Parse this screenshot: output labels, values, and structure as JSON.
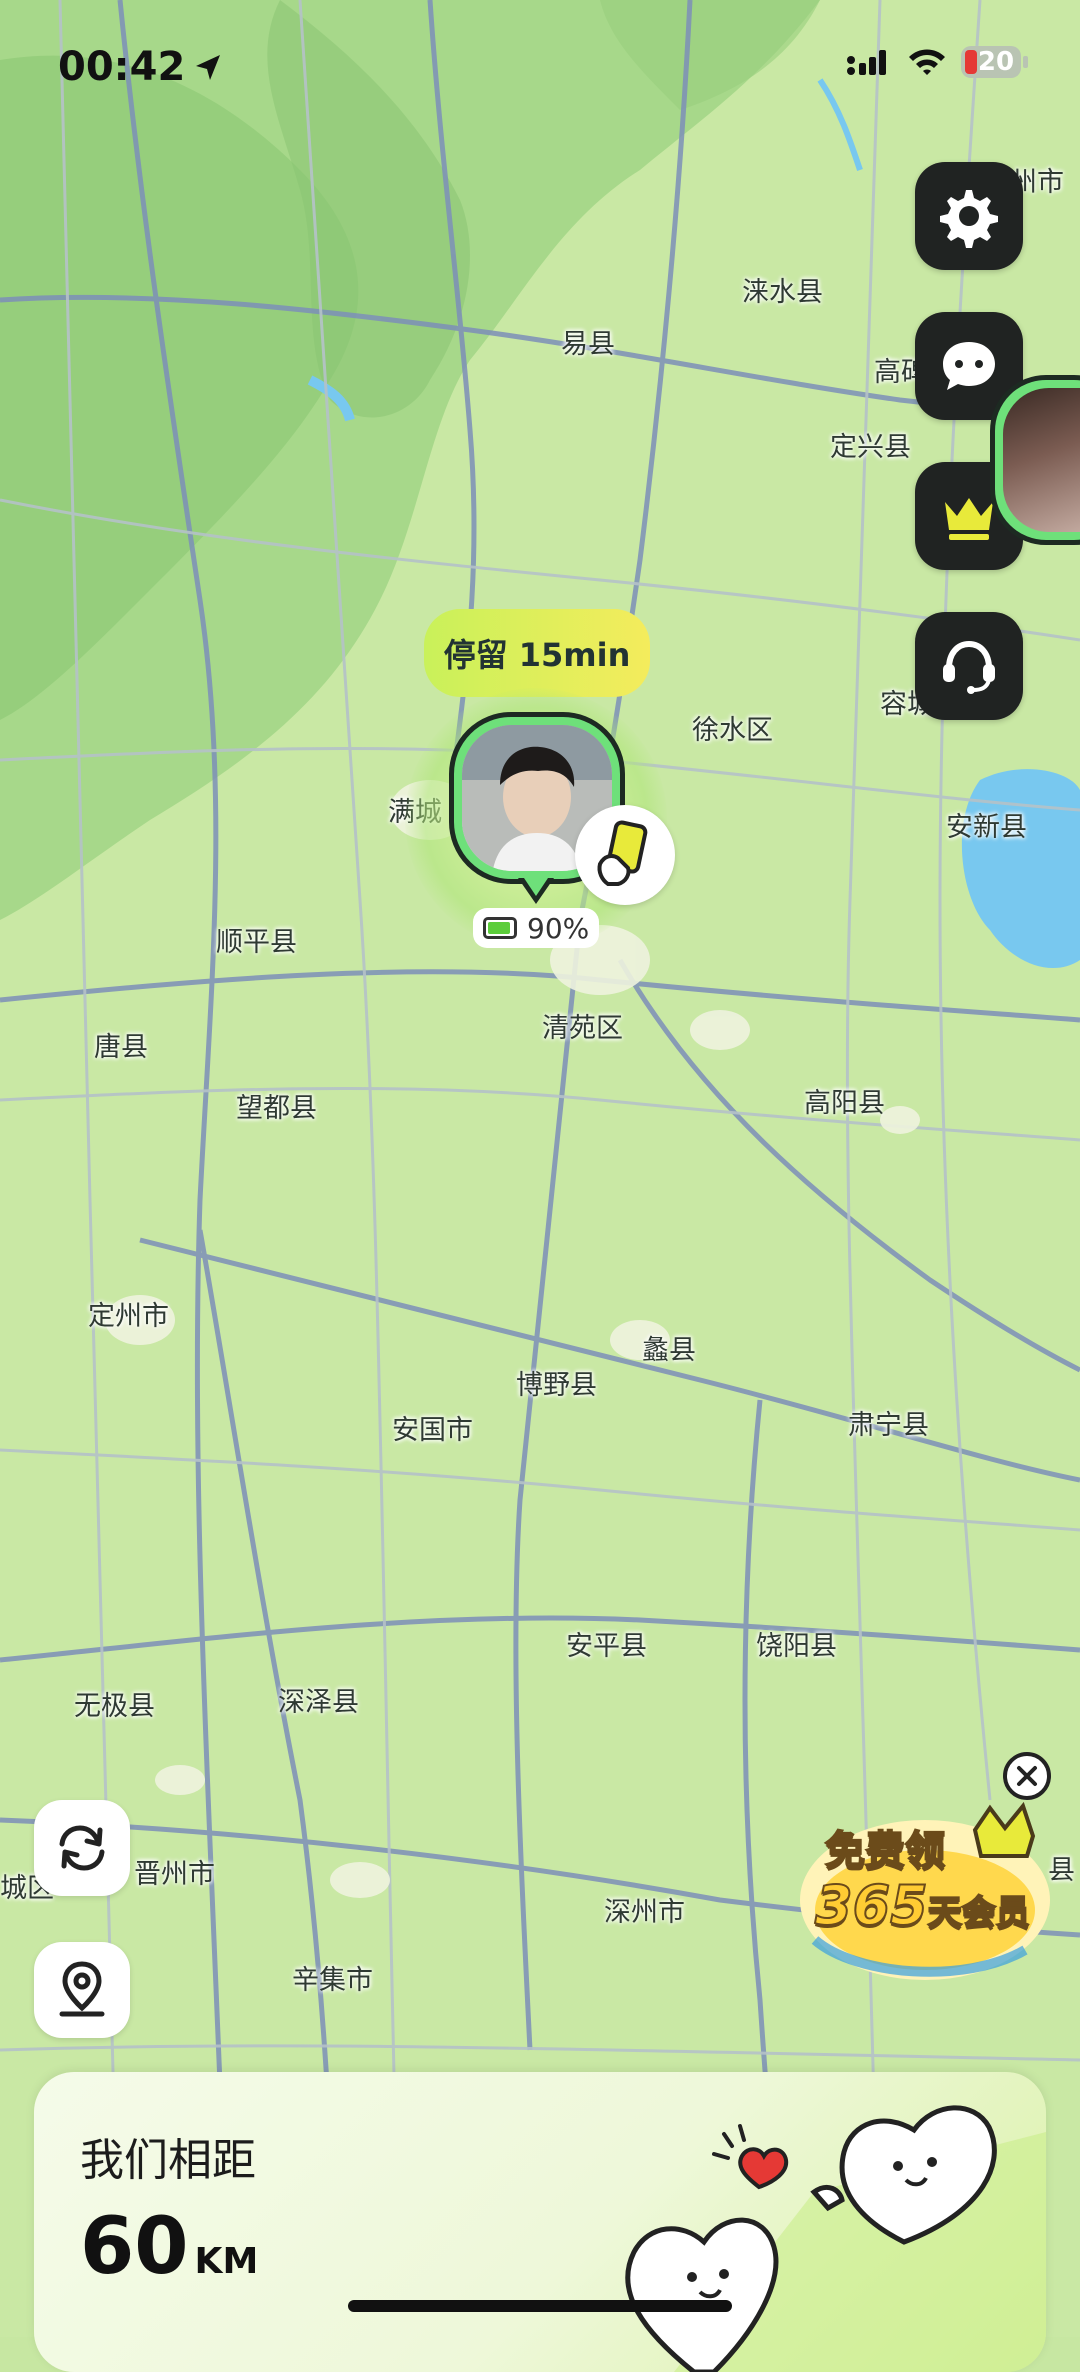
{
  "status_bar": {
    "time": "00:42",
    "battery": "20"
  },
  "map": {
    "labels": [
      {
        "text": "涞水县"
      },
      {
        "text": "易县"
      },
      {
        "text": "高碑"
      },
      {
        "text": "定兴县"
      },
      {
        "text": "州市"
      },
      {
        "text": "容城"
      },
      {
        "text": "徐水区"
      },
      {
        "text": "满城"
      },
      {
        "text": "安新县"
      },
      {
        "text": "顺平县"
      },
      {
        "text": "清苑区"
      },
      {
        "text": "唐县"
      },
      {
        "text": "望都县"
      },
      {
        "text": "高阳县"
      },
      {
        "text": "定州市"
      },
      {
        "text": "蠡县"
      },
      {
        "text": "博野县"
      },
      {
        "text": "安国市"
      },
      {
        "text": "肃宁县"
      },
      {
        "text": "安平县"
      },
      {
        "text": "饶阳县"
      },
      {
        "text": "无极县"
      },
      {
        "text": "深泽县"
      },
      {
        "text": "晋州市"
      },
      {
        "text": "城区"
      },
      {
        "text": "深州市"
      },
      {
        "text": "辛集市"
      },
      {
        "text": "县"
      }
    ]
  },
  "marker": {
    "stay_label": "停留 15min",
    "battery_percent": "90%"
  },
  "side_buttons": [
    {
      "icon": "gear-icon"
    },
    {
      "icon": "chat-icon"
    },
    {
      "icon": "crown-icon"
    },
    {
      "icon": "headset-icon"
    }
  ],
  "promo": {
    "line1": "免费领",
    "line2_num": "365",
    "line2_text": "天会员"
  },
  "distance_card": {
    "label": "我们相距",
    "value": "60",
    "unit": "KM"
  }
}
